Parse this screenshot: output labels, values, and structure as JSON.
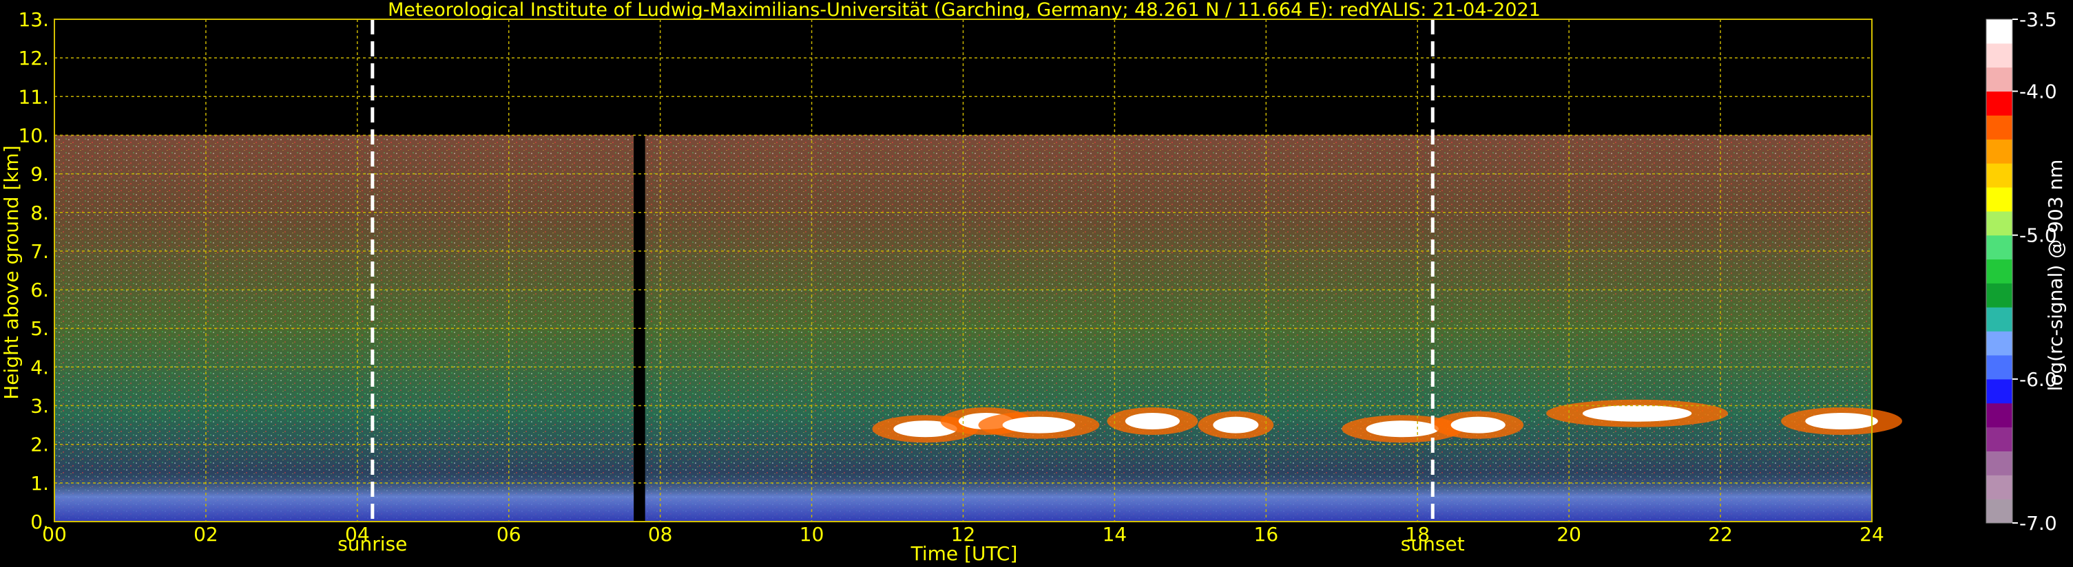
{
  "chart_data": {
    "type": "heatmap",
    "title": "Meteorological Institute of Ludwig-Maximilians-Universität (Garching, Germany; 48.261 N / 11.664 E):    redYALIS: 21-04-2021",
    "xlabel": "Time [UTC]",
    "ylabel": "Height above ground [km]",
    "xlim": [
      0,
      24
    ],
    "ylim": [
      0,
      13
    ],
    "x_ticks": [
      "00",
      "02",
      "04",
      "06",
      "08",
      "10",
      "12",
      "14",
      "16",
      "18",
      "20",
      "22",
      "24"
    ],
    "y_ticks": [
      "0.",
      "1.",
      "2.",
      "3.",
      "4.",
      "5.",
      "6.",
      "7.",
      "8.",
      "9.",
      "10.",
      "11.",
      "12.",
      "13."
    ],
    "grid": true,
    "data_top_km": 10,
    "data_gap_utc": [
      7.65,
      7.8
    ],
    "markers": [
      {
        "label": "sunrise",
        "time_utc": 4.2
      },
      {
        "label": "sunset",
        "time_utc": 18.2
      }
    ],
    "colorbar": {
      "label": "log(rc-signal) @ 903 nm",
      "range": [
        -7.0,
        -3.5
      ],
      "ticks": [
        "-3.5",
        "-4.0",
        "-5.0",
        "-6.0",
        "-7.0"
      ],
      "colors": [
        "#a89aa8",
        "#b690b0",
        "#a26ea2",
        "#902e8f",
        "#7b007b",
        "#1a1aff",
        "#4a72ff",
        "#7aa6ff",
        "#2ab8a8",
        "#10a030",
        "#22c83a",
        "#4ee07a",
        "#aaf060",
        "#ffff00",
        "#ffd000",
        "#ffa000",
        "#ff6000",
        "#ff0000",
        "#f3b0b0",
        "#ffd8d8",
        "#ffffff"
      ]
    }
  }
}
